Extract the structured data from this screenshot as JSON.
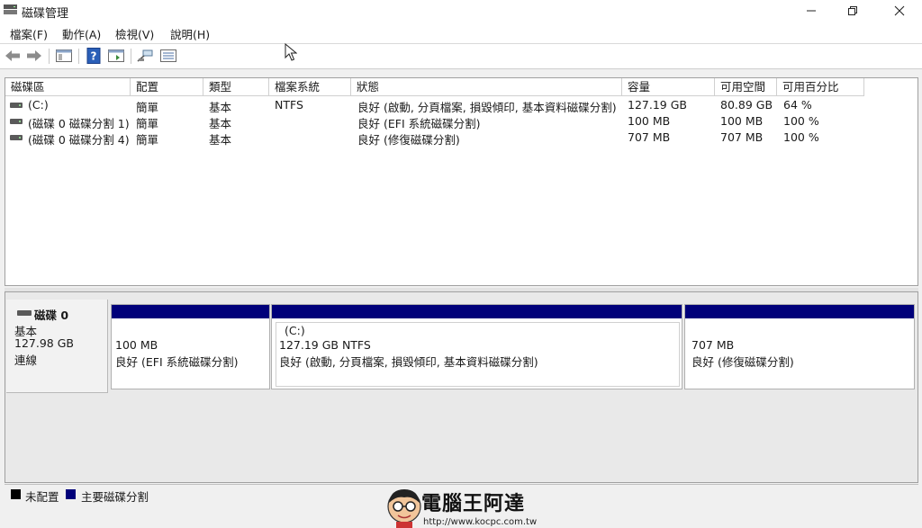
{
  "window": {
    "title": "磁碟管理"
  },
  "menu": [
    "檔案(F)",
    "動作(A)",
    "檢視(V)",
    "說明(H)"
  ],
  "toolbar": {
    "icons": [
      "back-arrow-icon",
      "forward-arrow-icon",
      "show-hide-tree-icon",
      "help-icon",
      "properties-icon",
      "connect-icon",
      "list-view-icon"
    ]
  },
  "volume_list": {
    "columns": [
      "磁碟區",
      "配置",
      "類型",
      "檔案系統",
      "狀態",
      "容量",
      "可用空間",
      "可用百分比"
    ],
    "rows": [
      [
        "(C:)",
        "簡單",
        "基本",
        "NTFS",
        "良好 (啟動, 分頁檔案, 損毀傾印, 基本資料磁碟分割)",
        "127.19 GB",
        "80.89 GB",
        "64 %"
      ],
      [
        "(磁碟 0 磁碟分割 1)",
        "簡單",
        "基本",
        "",
        "良好 (EFI 系統磁碟分割)",
        "100 MB",
        "100 MB",
        "100 %"
      ],
      [
        "(磁碟 0 磁碟分割 4)",
        "簡單",
        "基本",
        "",
        "良好 (修復磁碟分割)",
        "707 MB",
        "707 MB",
        "100 %"
      ]
    ]
  },
  "disk": {
    "name": "磁碟 0",
    "type": "基本",
    "size": "127.98 GB",
    "status": "連線",
    "partitions": [
      {
        "label": "",
        "size": "100 MB",
        "status": "良好 (EFI 系統磁碟分割)"
      },
      {
        "label": "(C:)",
        "size": "127.19 GB NTFS",
        "status": "良好 (啟動, 分頁檔案, 損毀傾印, 基本資料磁碟分割)"
      },
      {
        "label": "",
        "size": "707 MB",
        "status": "良好 (修復磁碟分割)"
      }
    ]
  },
  "legend": [
    {
      "label": "未配置",
      "color": "#000000"
    },
    {
      "label": "主要磁碟分割",
      "color": "#00007a"
    }
  ],
  "watermark": {
    "title": "電腦王阿達",
    "url": "http://www.kocpc.com.tw"
  },
  "colors": {
    "primary_partition": "#00007a",
    "unallocated": "#000000"
  }
}
